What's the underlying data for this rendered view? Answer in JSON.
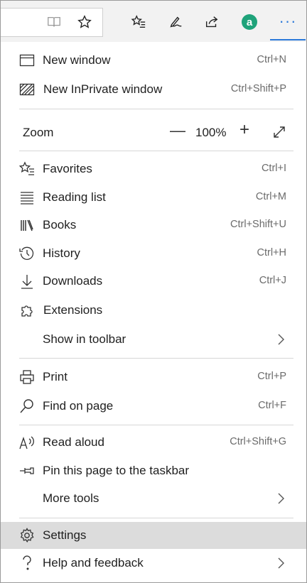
{
  "toolbar": {
    "icons": [
      "reading-view-icon",
      "favorite-star-icon",
      "favorites-list-icon",
      "pen-icon",
      "share-icon",
      "account-icon",
      "more-icon"
    ],
    "account_letter": "a",
    "more_label": "···",
    "accent_color": "#2b79d9",
    "account_color": "#1fa37a"
  },
  "menu": {
    "new_window": {
      "label": "New window",
      "shortcut": "Ctrl+N"
    },
    "new_inprivate": {
      "label": "New InPrivate window",
      "shortcut": "Ctrl+Shift+P"
    },
    "zoom": {
      "label": "Zoom",
      "minus": "—",
      "value": "100%",
      "plus": "+"
    },
    "favorites": {
      "label": "Favorites",
      "shortcut": "Ctrl+I"
    },
    "reading_list": {
      "label": "Reading list",
      "shortcut": "Ctrl+M"
    },
    "books": {
      "label": "Books",
      "shortcut": "Ctrl+Shift+U"
    },
    "history": {
      "label": "History",
      "shortcut": "Ctrl+H"
    },
    "downloads": {
      "label": "Downloads",
      "shortcut": "Ctrl+J"
    },
    "extensions": {
      "label": "Extensions"
    },
    "show_in_toolbar": {
      "label": "Show in toolbar"
    },
    "print": {
      "label": "Print",
      "shortcut": "Ctrl+P"
    },
    "find_on_page": {
      "label": "Find on page",
      "shortcut": "Ctrl+F"
    },
    "read_aloud": {
      "label": "Read aloud",
      "shortcut": "Ctrl+Shift+G"
    },
    "pin_taskbar": {
      "label": "Pin this page to the taskbar"
    },
    "more_tools": {
      "label": "More tools"
    },
    "settings": {
      "label": "Settings",
      "selected": true
    },
    "help_feedback": {
      "label": "Help and feedback"
    }
  }
}
